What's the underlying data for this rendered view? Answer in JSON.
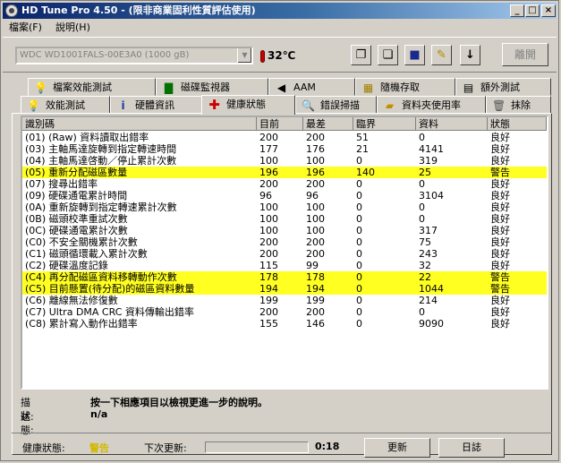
{
  "window": {
    "title": "HD Tune Pro 4.50 - (限非商業固利性質評估使用)"
  },
  "menu": {
    "items": [
      "檔案(F)",
      "說明(H)"
    ]
  },
  "toolbar": {
    "drive": "WDC WD1001FALS-00E3A0 (1000 gB)",
    "temperature": "32℃",
    "exit_label": "離開",
    "tool_icons": [
      "copy-icon",
      "copy-info-icon",
      "save-icon",
      "options-icon",
      "download-icon"
    ]
  },
  "tabs_row1": [
    {
      "label": "檔案效能測試",
      "icon": "file-bench-icon"
    },
    {
      "label": "磁碟監視器",
      "icon": "disk-monitor-icon"
    },
    {
      "label": "AAM",
      "icon": "speaker-icon"
    },
    {
      "label": "隨機存取",
      "icon": "random-access-icon"
    },
    {
      "label": "額外測試",
      "icon": "extra-tests-icon"
    }
  ],
  "tabs_row2": [
    {
      "label": "效能測試",
      "icon": "benchmark-icon"
    },
    {
      "label": "硬體資訊",
      "icon": "info-icon"
    },
    {
      "label": "健康狀態",
      "icon": "health-cross-icon"
    },
    {
      "label": "錯誤掃描",
      "icon": "magnifier-icon"
    },
    {
      "label": "資料夾使用率",
      "icon": "folder-icon"
    },
    {
      "label": "抹除",
      "icon": "trash-icon"
    }
  ],
  "table": {
    "headers": [
      "識別碼",
      "目前",
      "最差",
      "臨界",
      "資料",
      "狀態"
    ],
    "rows": [
      {
        "id": "(01) (Raw) 資料讀取出錯率",
        "cur": "200",
        "worst": "200",
        "thr": "51",
        "data": "0",
        "status": "良好",
        "warn": false
      },
      {
        "id": "(03) 主軸馬達旋轉到指定轉速時間",
        "cur": "177",
        "worst": "176",
        "thr": "21",
        "data": "4141",
        "status": "良好",
        "warn": false
      },
      {
        "id": "(04) 主軸馬達啓動／停止累計次數",
        "cur": "100",
        "worst": "100",
        "thr": "0",
        "data": "319",
        "status": "良好",
        "warn": false
      },
      {
        "id": "(05) 重新分配磁區數量",
        "cur": "196",
        "worst": "196",
        "thr": "140",
        "data": "25",
        "status": "警告",
        "warn": true
      },
      {
        "id": "(07) 搜尋出錯率",
        "cur": "200",
        "worst": "200",
        "thr": "0",
        "data": "0",
        "status": "良好",
        "warn": false
      },
      {
        "id": "(09) 硬碟通電累計時間",
        "cur": "96",
        "worst": "96",
        "thr": "0",
        "data": "3104",
        "status": "良好",
        "warn": false
      },
      {
        "id": "(0A) 重新旋轉到指定轉速累計次數",
        "cur": "100",
        "worst": "100",
        "thr": "0",
        "data": "0",
        "status": "良好",
        "warn": false
      },
      {
        "id": "(0B) 磁頭校準重試次數",
        "cur": "100",
        "worst": "100",
        "thr": "0",
        "data": "0",
        "status": "良好",
        "warn": false
      },
      {
        "id": "(0C) 硬碟通電累計次數",
        "cur": "100",
        "worst": "100",
        "thr": "0",
        "data": "317",
        "status": "良好",
        "warn": false
      },
      {
        "id": "(C0) 不安全關機累計次數",
        "cur": "200",
        "worst": "200",
        "thr": "0",
        "data": "75",
        "status": "良好",
        "warn": false
      },
      {
        "id": "(C1) 磁頭循環載入累計次數",
        "cur": "200",
        "worst": "200",
        "thr": "0",
        "data": "243",
        "status": "良好",
        "warn": false
      },
      {
        "id": "(C2) 硬碟溫度記錄",
        "cur": "115",
        "worst": "99",
        "thr": "0",
        "data": "32",
        "status": "良好",
        "warn": false
      },
      {
        "id": "(C4) 再分配磁區資料移轉動作次數",
        "cur": "178",
        "worst": "178",
        "thr": "0",
        "data": "22",
        "status": "警告",
        "warn": true
      },
      {
        "id": "(C5) 目前懸置(待分配)的磁區資料數量",
        "cur": "194",
        "worst": "194",
        "thr": "0",
        "data": "1044",
        "status": "警告",
        "warn": true
      },
      {
        "id": "(C6) 離線無法修復數",
        "cur": "199",
        "worst": "199",
        "thr": "0",
        "data": "214",
        "status": "良好",
        "warn": false
      },
      {
        "id": "(C7) Ultra DMA CRC 資料傳輸出錯率",
        "cur": "200",
        "worst": "200",
        "thr": "0",
        "data": "0",
        "status": "良好",
        "warn": false
      },
      {
        "id": "(C8) 累計寫入動作出錯率",
        "cur": "155",
        "worst": "146",
        "thr": "0",
        "data": "9090",
        "status": "良好",
        "warn": false
      }
    ]
  },
  "info": {
    "desc_label": "描述:",
    "desc_value": "按一下相應項目以檢視更進一步的說明。",
    "state_label": "狀態:",
    "state_value": "n/a"
  },
  "status_bar": {
    "health_label": "健康狀態:",
    "health_value": "警告",
    "health_color": "#d4b800",
    "next_update_label": "下次更新:",
    "progress": 0,
    "time": "0:18",
    "update_label": "更新",
    "log_label": "日誌"
  }
}
